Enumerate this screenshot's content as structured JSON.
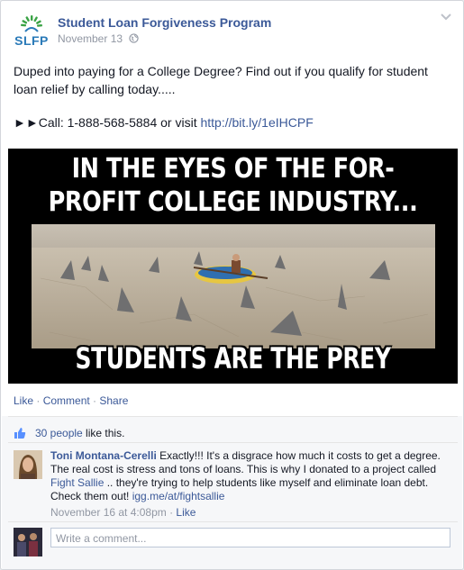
{
  "post": {
    "page_name": "Student Loan Forgiveness Program",
    "logo_text": "SLFP",
    "date": "November 13",
    "text_line1": "Duped into paying for a College Degree? Find out if you qualify for student loan relief by calling today.....",
    "call_prefix": "►►Call: 1-888-568-5884 or visit",
    "link": "http://bit.ly/1eIHCPF"
  },
  "meme": {
    "top_line1": "IN THE EYES OF THE FOR-",
    "top_line2": "PROFIT COLLEGE INDUSTRY...",
    "bottom": "STUDENTS ARE THE PREY"
  },
  "actions": {
    "like": "Like",
    "comment": "Comment",
    "share": "Share",
    "sep": " · "
  },
  "likes": {
    "count_link": "30 people",
    "suffix": " like this."
  },
  "comment": {
    "author": "Toni Montana-Cerelli",
    "text1": " Exactly!!! It's a disgrace how much it costs to get a degree. The real cost is stress and tons of loans. This is why I donated to a project called ",
    "link1": "Fight Sallie",
    "text2": " .. they're trying to help students like myself and eliminate loan debt. Check them out! ",
    "link2": "igg.me/at/fightsallie",
    "meta_date": "November 16 at 4:08pm",
    "meta_sep": " · ",
    "meta_like": "Like"
  },
  "comment_input": {
    "placeholder": "Write a comment..."
  },
  "colors": {
    "link": "#3b5998",
    "text": "#141823",
    "muted": "#9197a3",
    "logo_blue": "#2a7ab8",
    "logo_green": "#3aa345"
  },
  "icons": [
    "globe-icon",
    "chevron-down-icon",
    "thumbs-up-icon",
    "logo-sunburst-icon"
  ]
}
